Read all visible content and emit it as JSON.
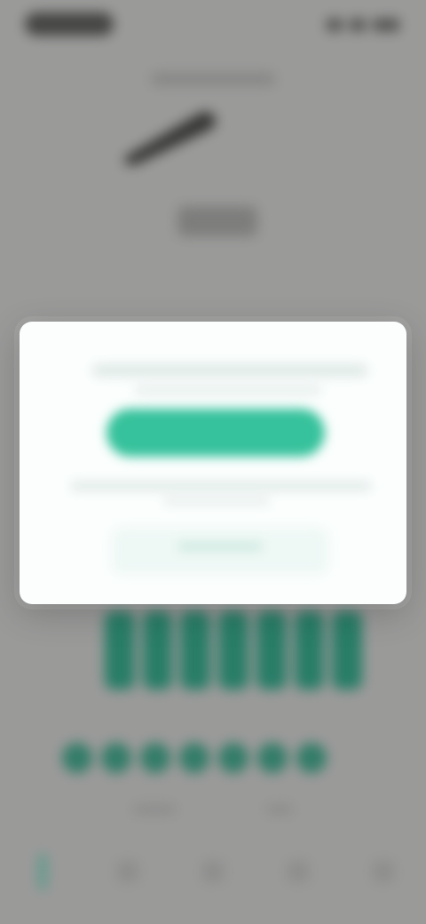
{
  "status_bar": {
    "time": "",
    "icons": [
      "signal-icon",
      "wifi-icon",
      "battery-icon"
    ]
  },
  "background": {
    "top_label": "",
    "illustration_icon": "pencil-icon",
    "mid_label": "",
    "bars_count": 7,
    "dots_count": 7,
    "footer_labels": [
      "",
      ""
    ]
  },
  "tabbar": {
    "items": [
      {
        "icon": "home-icon",
        "label": "",
        "active": true
      },
      {
        "icon": "book-icon",
        "label": "",
        "active": false
      },
      {
        "icon": "star-icon",
        "label": "",
        "active": false
      },
      {
        "icon": "chart-icon",
        "label": "",
        "active": false
      },
      {
        "icon": "profile-icon",
        "label": "",
        "active": false
      }
    ]
  },
  "modal": {
    "title": "",
    "subtitle": "",
    "primary_button_label": "",
    "body_line_1": "",
    "body_line_2": "",
    "secondary_link_label": ""
  },
  "colors": {
    "accent": "#36c29c",
    "accent_dark": "#1f7b63",
    "overlay": "#9a9a99",
    "modal_bg": "#fbfefd"
  }
}
